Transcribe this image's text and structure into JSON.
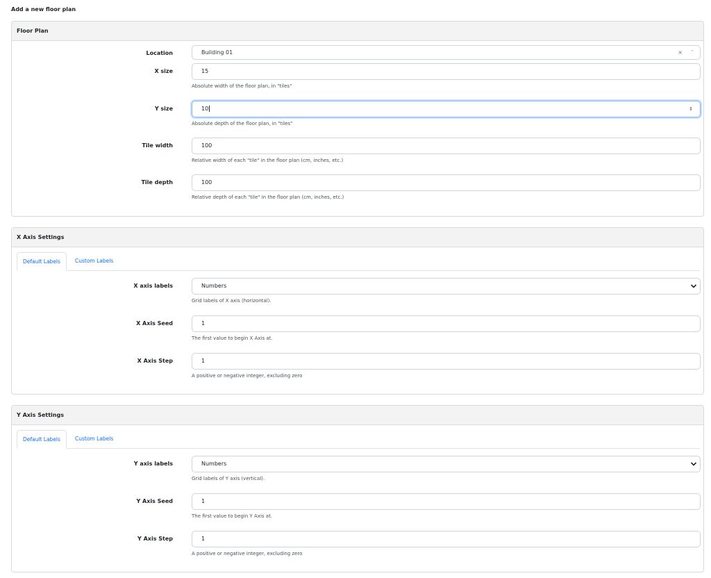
{
  "page": {
    "title": "Add a new floor plan"
  },
  "floor_plan": {
    "header": "Floor Plan",
    "location": {
      "label": "Location",
      "value": "Building 01",
      "clear": "×",
      "caret": "⌃"
    },
    "x_size": {
      "label": "X size",
      "value": "15",
      "help": "Absolute width of the floor plan, in \"tiles\""
    },
    "y_size": {
      "label": "Y size",
      "value": "10",
      "help": "Absolute depth of the floor plan, in \"tiles\"",
      "spinner": "⇕"
    },
    "tile_width": {
      "label": "Tile width",
      "value": "100",
      "help": "Relative width of each \"tile\" in the floor plan (cm, inches, etc.)"
    },
    "tile_depth": {
      "label": "Tile depth",
      "value": "100",
      "help": "Relative depth of each \"tile\" in the floor plan (cm, inches, etc.)"
    }
  },
  "x_axis": {
    "header": "X Axis Settings",
    "tabs": [
      "Default Labels",
      "Custom Labels"
    ],
    "labels": {
      "label": "X axis labels",
      "value": "Numbers",
      "help": "Grid labels of X axis (horizontal)."
    },
    "seed": {
      "label": "X Axis Seed",
      "value": "1",
      "help": "The first value to begin X Axis at."
    },
    "step": {
      "label": "X Axis Step",
      "value": "1",
      "help": "A positive or negative integer, excluding zero"
    }
  },
  "y_axis": {
    "header": "Y Axis Settings",
    "tabs": [
      "Default Labels",
      "Custom Labels"
    ],
    "labels": {
      "label": "Y axis labels",
      "value": "Numbers",
      "help": "Grid labels of Y axis (vertical)."
    },
    "seed": {
      "label": "Y Axis Seed",
      "value": "1",
      "help": "The first value to begin Y Axis at."
    },
    "step": {
      "label": "Y Axis Step",
      "value": "1",
      "help": "A positive or negative integer, excluding zero"
    }
  },
  "colors": {
    "focus_border": "#86b7fe",
    "tab_link": "#0d6efd",
    "panel_header_bg": "#f3f3f3"
  },
  "icons": {
    "select_chevron": "chevron-down-icon",
    "clear": "close-icon"
  }
}
